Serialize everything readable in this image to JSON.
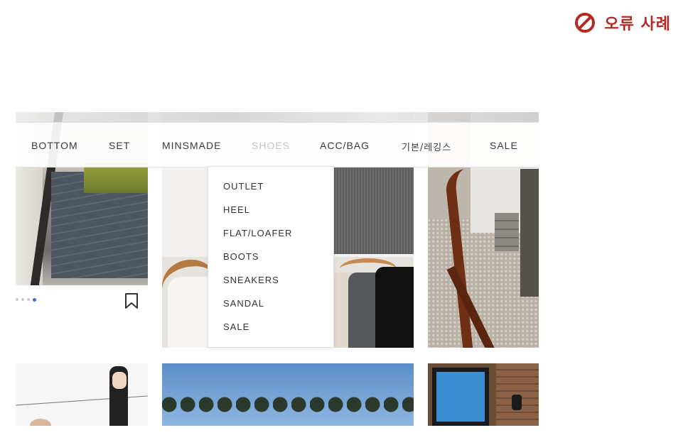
{
  "badge": {
    "icon": "no-entry-icon",
    "label": "오류 사례",
    "color": "#b32a24"
  },
  "nav": {
    "items": [
      {
        "label": "BOTTOM"
      },
      {
        "label": "SET"
      },
      {
        "label": "MINSMADE"
      },
      {
        "label": "SHOES",
        "state": "hover"
      },
      {
        "label": "ACC/BAG"
      },
      {
        "label": "기본/레깅스"
      },
      {
        "label": "SALE"
      }
    ]
  },
  "dropdown": {
    "parent": "SHOES",
    "items": [
      {
        "label": "OUTLET"
      },
      {
        "label": "HEEL"
      },
      {
        "label": "FLAT/LOAFER"
      },
      {
        "label": "BOOTS"
      },
      {
        "label": "SNEAKERS"
      },
      {
        "label": "SANDAL"
      },
      {
        "label": "SALE"
      }
    ]
  },
  "carousel": {
    "dot_count": 4,
    "active_dot": 4,
    "active_color": "#2f6fd8"
  },
  "product": {
    "bookmark_icon": "bookmark-icon"
  }
}
